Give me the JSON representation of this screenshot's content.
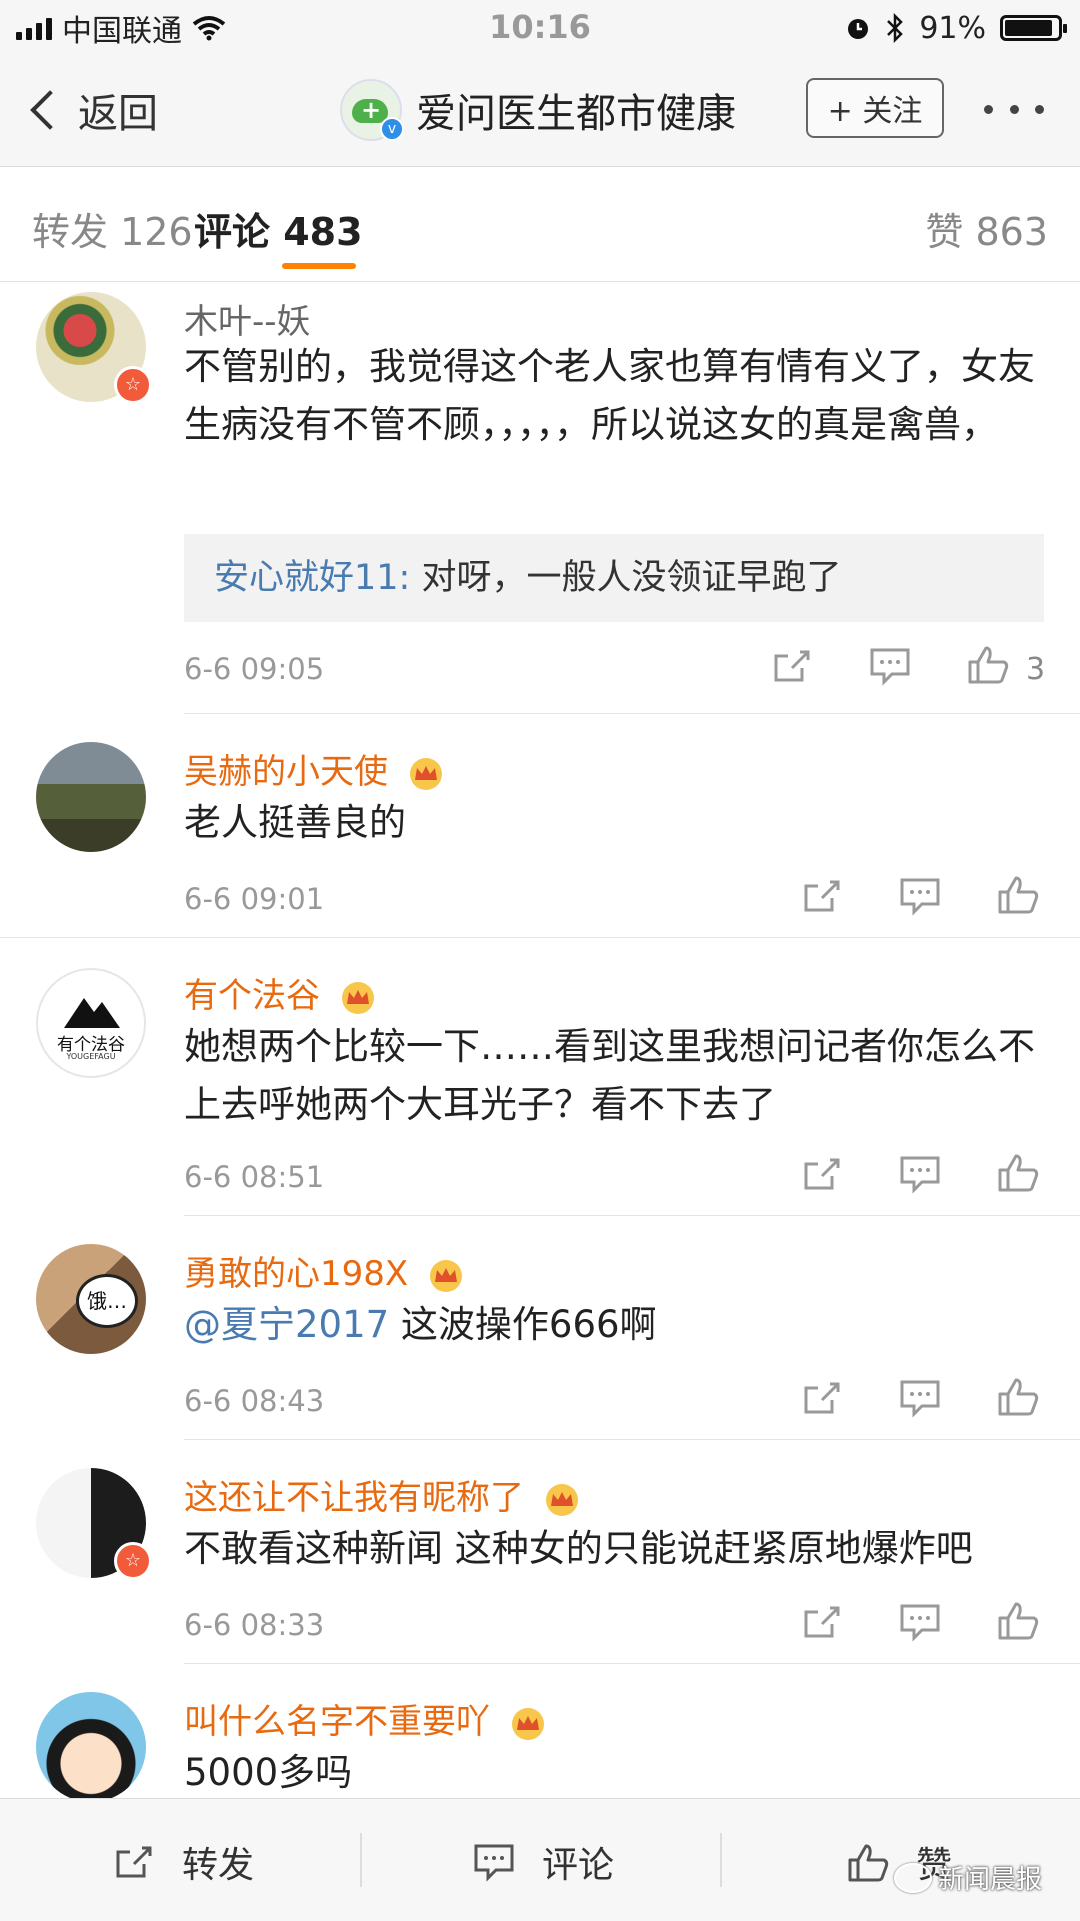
{
  "status_bar": {
    "carrier": "中国联通",
    "time": "10:16",
    "battery_percent": "91%",
    "battery_level": 0.91
  },
  "nav": {
    "back_label": "返回",
    "account_name": "爱问医生都市健康",
    "follow_label": "+ 关注"
  },
  "tabs": {
    "reposts": "转发 126",
    "comments": "评论 483",
    "likes": "赞 863"
  },
  "comments": [
    {
      "user": "木叶--妖",
      "text": "不管别的，我觉得这个老人家也算有情有义了，女友生病没有不管不顾，，，，，所以说这女的真是禽兽，",
      "reply_user": "安心就好11:",
      "reply_text": " 对呀，一般人没领证早跑了",
      "time": "6-6 09:05",
      "likes": "3"
    },
    {
      "user": "吴赫的小天使",
      "text": "老人挺善良的",
      "time": "6-6 09:01"
    },
    {
      "user": "有个法谷",
      "text": "她想两个比较一下……看到这里我想问记者你怎么不上去呼她两个大耳光子？看不下去了",
      "avatar_text": "有个法谷",
      "avatar_subtext": "YOUGEFAGU",
      "time": "6-6 08:51"
    },
    {
      "user": "勇敢的心198X",
      "mention": "@夏宁2017",
      "text": " 这波操作666啊",
      "avatar_text": "饿…",
      "time": "6-6 08:43"
    },
    {
      "user": "这还让不让我有昵称了",
      "text": "不敢看这种新闻 这种女的只能说赶紧原地爆炸吧",
      "time": "6-6 08:33"
    },
    {
      "user": "叫什么名字不重要吖",
      "text": "5000多吗"
    }
  ],
  "bottom_bar": {
    "repost": "转发",
    "comment": "评论",
    "like": "赞"
  },
  "watermark": "新闻晨报",
  "colors": {
    "accent_orange": "#ff8200",
    "vip_name": "#e86a10",
    "link_blue": "#4a7bb0"
  }
}
